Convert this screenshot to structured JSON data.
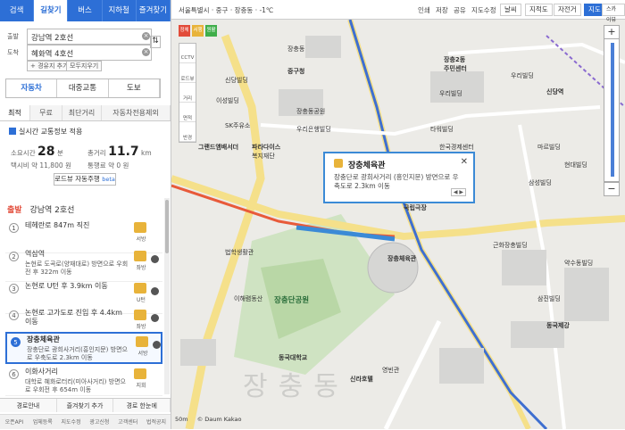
{
  "tabs": [
    "검색",
    "길찾기",
    "버스",
    "지하철",
    "즐겨찾기"
  ],
  "route": {
    "origin_label": "출발",
    "origin_value": "강남역 2호선",
    "dest_label": "도착",
    "dest_value": "혜화역 4호선",
    "add_waypoint": "+ 경유지 추가",
    "clear_all": "모두지우기"
  },
  "modes": [
    "자동차",
    "대중교통",
    "도보"
  ],
  "subtabs": [
    "최적",
    "무료",
    "최단거리",
    "자동차전용제외"
  ],
  "realtime_label": "실시간 교통정보 적용",
  "summary": {
    "time_label": "소요시간",
    "time_value": "28",
    "time_unit": "분",
    "dist_label": "총거리",
    "dist_value": "11.7",
    "dist_unit": "km",
    "taxi_label": "택시비",
    "taxi_value": "약 11,800 원",
    "fuel_label": "통행료",
    "fuel_value": "약 0 원"
  },
  "roadview_label": "로드뷰 자동주행",
  "roadview_badge": "beta",
  "start_tag": "출발",
  "start_name": "강남역 2호선",
  "steps": [
    {
      "num": "1",
      "title": "테헤란로 847m 직진",
      "desc": "",
      "dir": "서방"
    },
    {
      "num": "2",
      "title": "역삼역",
      "desc": "논현로 도곡로(양재대로) 방면으로 우회전 후 322m 이동",
      "dir": "좌방"
    },
    {
      "num": "3",
      "title": "논현로 U턴 후 3.9km 이동",
      "desc": "",
      "dir": "U턴"
    },
    {
      "num": "4",
      "title": "논현로 고가도로 진입 후 4.4km 이동",
      "desc": "",
      "dir": "좌방"
    },
    {
      "num": "5",
      "title": "장충체육관",
      "desc": "장충단로 광희사거리(흥인지문) 방면으로 우축도로 2.3km 이동",
      "dir": "서방"
    },
    {
      "num": "6",
      "title": "이화사거리",
      "desc": "대학로 혜화로터리(미아사거리) 방면으로 우회전 후 654m 이동",
      "dir": "지회"
    }
  ],
  "bottom_buttons": [
    "경로안내",
    "즐겨찾기 추가",
    "경로 한눈에"
  ],
  "footer": [
    "오픈API",
    "업체등록",
    "지도수정",
    "광고신청",
    "고객센터",
    "법적공지"
  ],
  "map": {
    "location": "서울특별시 · 중구 · 장충동 · -1℃",
    "top_items": [
      "인쇄",
      "저장",
      "공유",
      "지도수정"
    ],
    "top_buttons": [
      "날씨",
      "지적도",
      "자전거"
    ],
    "view_buttons": [
      "지도",
      "스카이뷰"
    ],
    "left_tools": [
      "CCTV",
      "로드뷰",
      "거리",
      "면적",
      "반경"
    ],
    "legend": [
      "정체",
      "서행",
      "원활"
    ],
    "popup_title": "장충체육관",
    "popup_desc": "장충단로 광희사거리 (흥인지문) 방면으로 우축도로 2.3km 이동",
    "popup_nav": "◀ ▶",
    "scale": "50m",
    "copyright": "© Daum Kakao",
    "watermark": "장충동",
    "labels": [
      "중구청",
      "장충동",
      "신당빌딩",
      "이성빌딩",
      "SK주유소",
      "그랜드앰배서더",
      "파라다이스",
      "복지재단",
      "우리은행빌딩",
      "장충동공원",
      "장충체육관",
      "장충단공원",
      "법학생활관",
      "이해렴동산",
      "동국대학교",
      "신라호텔",
      "영빈관",
      "삼성빌딩",
      "한국경제센터",
      "타워빌딩",
      "우리빌딩",
      "마르빌딩",
      "국립극장",
      "근화장충빌딩",
      "약수동빌딩",
      "현대빌딩",
      "삼진빌딩",
      "동국제강",
      "우리빌딩",
      "장충2동",
      "주민센터",
      "신당역"
    ]
  }
}
